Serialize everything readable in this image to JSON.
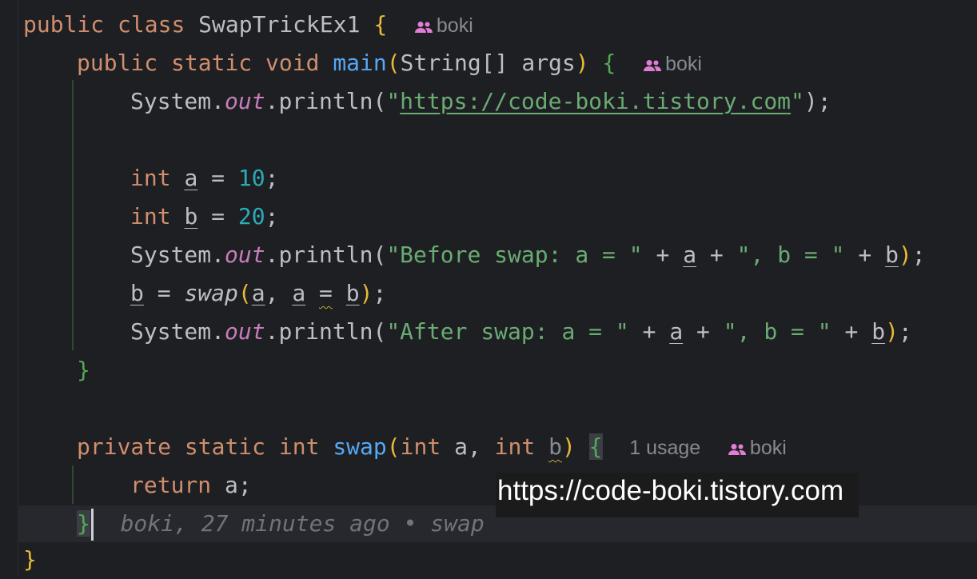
{
  "author": "boki",
  "hint_usage": "1 usage",
  "code": {
    "l1_public": "public",
    "l1_class": "class",
    "l1_name": "SwapTrickEx1",
    "l1_brace": "{",
    "l2_public": "public",
    "l2_static": "static",
    "l2_void": "void",
    "l2_main": "main",
    "l2_paren_open": "(",
    "l2_params": "String[] args",
    "l2_paren_close": ")",
    "l2_brace": "{",
    "system": "System.",
    "out": "out",
    "println": ".println(",
    "url_string_prefix": "\"",
    "url": "https://code-boki.tistory.com",
    "url_string_suffix": "\"",
    "close_stmt": ");",
    "int": "int",
    "var_a": "a",
    "var_b": "b",
    "assign": " = ",
    "val_10": "10",
    "val_20": "20",
    "semi": ";",
    "before_str": "\"Before swap: a = \"",
    "after_str": "\"After swap: a = \"",
    "b_eq_str": "\", b = \"",
    "plus": " + ",
    "close_paren": ")",
    "swap_call": "swap",
    "swap_args_open": "(",
    "comma": ", ",
    "eq_sign": "=",
    "main_close": "}",
    "l11_private": "private",
    "l11_static": "static",
    "l11_int": "int",
    "l11_swap": "swap",
    "l11_param_a": "int a, ",
    "l11_param_b_type": "int",
    "l11_brace": "{",
    "return_kw": "return",
    "return_val": " a;",
    "swap_close": "}",
    "blame": "boki, 27 minutes ago • swap",
    "class_close": "}"
  },
  "watermark": "https://code-boki.tistory.com",
  "colors": {
    "background": "#1e1f22",
    "keyword": "#cf8e6d",
    "function": "#56a8f5",
    "number": "#2aacb8",
    "string": "#6aab73",
    "static_field": "#c77dbb",
    "hint": "#868a91",
    "author_icon": "#e07dd6"
  },
  "icons": {
    "author": "people-icon"
  }
}
